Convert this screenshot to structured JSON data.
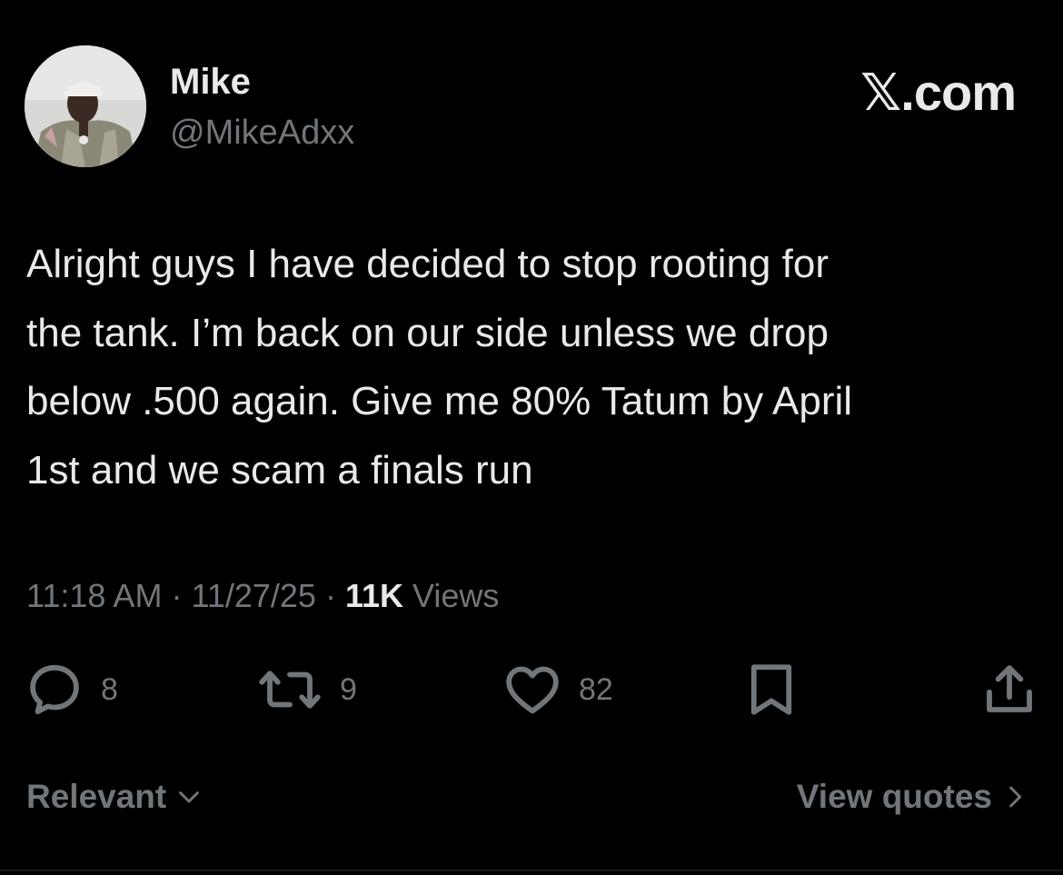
{
  "author": {
    "display_name": "Mike",
    "handle": "@MikeAdxx",
    "avatar_icon": "profile-photo"
  },
  "brand": {
    "label": "𝕏.com"
  },
  "tweet": {
    "text": "Alright guys I have decided to stop rooting for\nthe tank. I’m back on our side unless we drop\nbelow .500 again. Give me 80% Tatum by April\n1st and we scam a finals run"
  },
  "meta": {
    "time": "11:18 AM",
    "separator": "·",
    "date": "11/27/25",
    "views_count": "11K",
    "views_label": "Views"
  },
  "actions": {
    "replies": {
      "icon": "reply-icon",
      "count": "8"
    },
    "reposts": {
      "icon": "repost-icon",
      "count": "9"
    },
    "likes": {
      "icon": "heart-icon",
      "count": "82"
    },
    "bookmark": {
      "icon": "bookmark-icon"
    },
    "share": {
      "icon": "share-icon"
    }
  },
  "footer": {
    "sort_label": "Relevant",
    "quotes_label": "View quotes"
  },
  "colors": {
    "background": "#000000",
    "primary_text": "#e7e9ea",
    "secondary_text": "#71767b"
  }
}
